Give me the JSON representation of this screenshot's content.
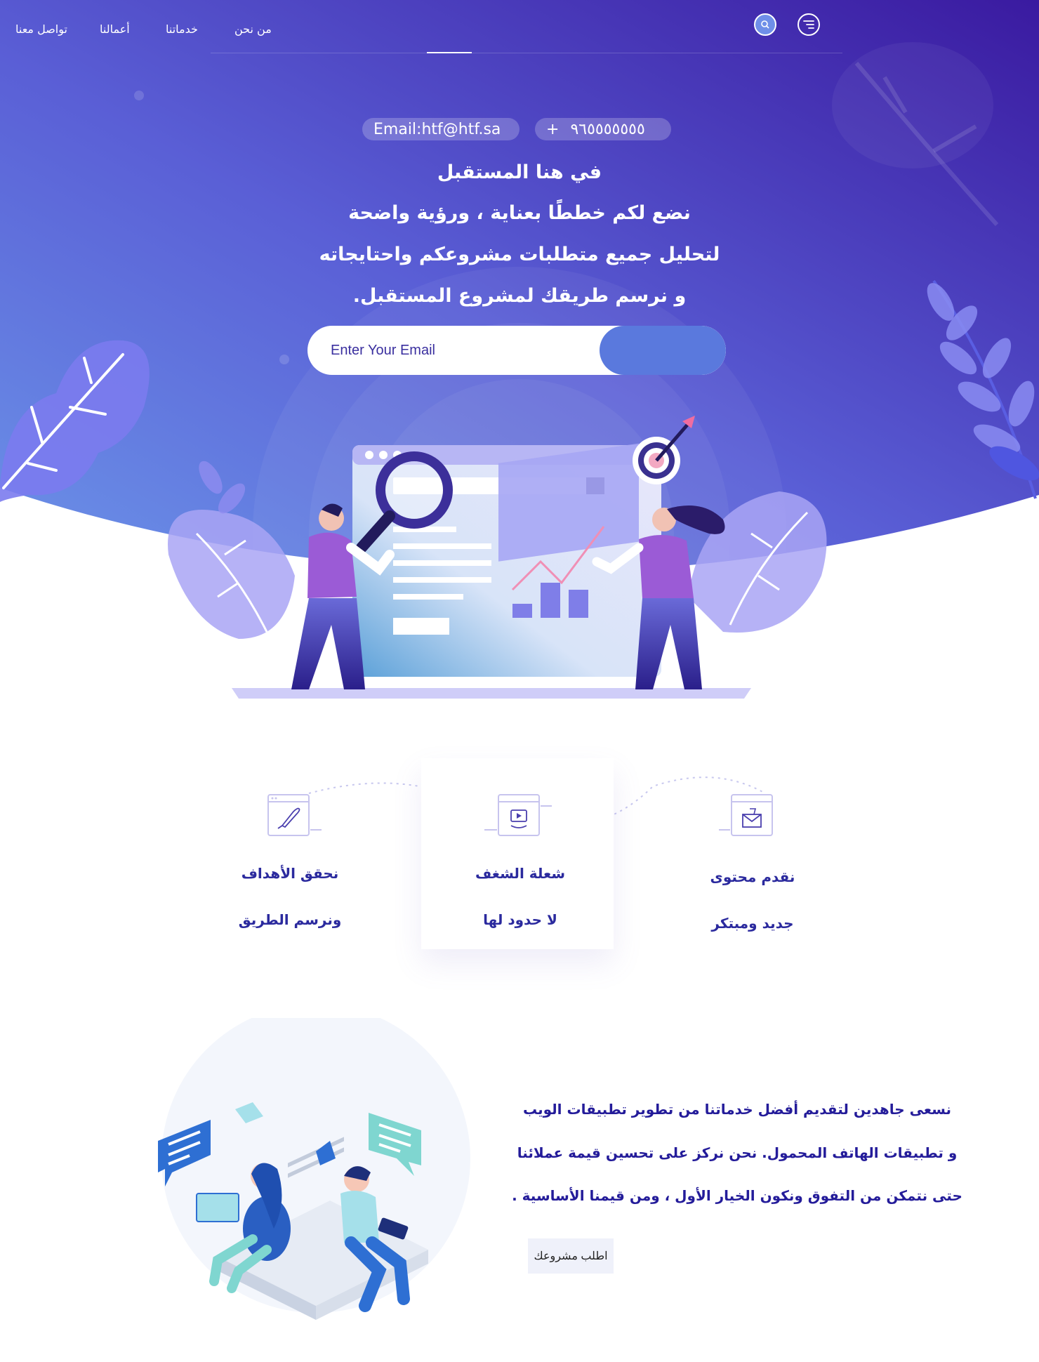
{
  "nav": {
    "links": [
      "من نحن",
      "خدماتنا",
      "أعمالنا",
      "تواصل معنا"
    ]
  },
  "contact": {
    "email": "Email:htf@htf.sa",
    "phone_prefix": "+",
    "phone": "٩٦٥٥٥٥٥٥٥"
  },
  "hero": {
    "lines": [
      "في هنا المستقبل",
      "نضع لكم خططًا بعناية ، ورؤية واضحة",
      "لتحليل جميع متطلبات مشروعكم واحتايجاته",
      "و نرسم طريقك لمشروع المستقبل."
    ]
  },
  "subscribe": {
    "placeholder": "Enter Your Email"
  },
  "features": [
    {
      "line1": "نحقق الأهداف",
      "line2": "ونرسم الطريق",
      "icon": "rocket-icon"
    },
    {
      "line1": "شعلة الشغف",
      "line2": "لا حدود لها",
      "icon": "video-icon"
    },
    {
      "line1": "نقدم محتوى",
      "line2": "جديد ومبتكر",
      "icon": "mail-icon"
    }
  ],
  "about": {
    "lines": [
      "نسعى جاهدين لتقديم أفضل خدماتنا من تطوير تطبيقات الويب",
      "و تطبيقات الهاتف المحمول. نحن نركز على تحسين قيمة عملائنا",
      "حتى نتمكن من التفوق ونكون الخيار الأول ، ومن قيمنا الأساسية ."
    ],
    "button_label": "اطلب مشروعك"
  },
  "colors": {
    "hero_start": "#6b93e8",
    "hero_end": "#3a1aa0",
    "text_dark_blue": "#2b2a9e",
    "button_blue": "#5a79dd"
  }
}
